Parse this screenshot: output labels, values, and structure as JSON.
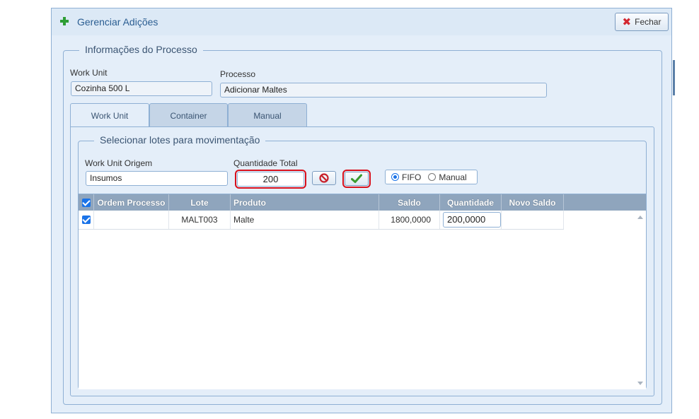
{
  "dialog": {
    "title": "Gerenciar Adições",
    "close_label": "Fechar"
  },
  "process_info": {
    "legend": "Informações do Processo",
    "work_unit_label": "Work Unit",
    "work_unit_value": "Cozinha 500 L",
    "process_label": "Processo",
    "process_value": "Adicionar Maltes"
  },
  "tabs": [
    {
      "label": "Work Unit",
      "active": true
    },
    {
      "label": "Container",
      "active": false
    },
    {
      "label": "Manual",
      "active": false
    }
  ],
  "lot_selection": {
    "legend": "Selecionar lotes para movimentação",
    "origin_label": "Work Unit Origem",
    "origin_value": "Insumos",
    "total_qty_label": "Quantidade Total",
    "total_qty_value": "200",
    "radio_fifo": "FIFO",
    "radio_manual": "Manual",
    "selected_mode": "FIFO"
  },
  "grid": {
    "columns": [
      "Ordem Processo",
      "Lote",
      "Produto",
      "Saldo",
      "Quantidade",
      "Novo Saldo"
    ],
    "rows": [
      {
        "checked": true,
        "ordem": "",
        "lote": "MALT003",
        "produto": "Malte",
        "saldo": "1800,0000",
        "quantidade": "200,0000",
        "novo_saldo": ""
      }
    ]
  },
  "colors": {
    "accent": "#1a73e8",
    "header": "#8fa5bd",
    "highlight": "#d8101c",
    "panel": "#e4eef9"
  }
}
